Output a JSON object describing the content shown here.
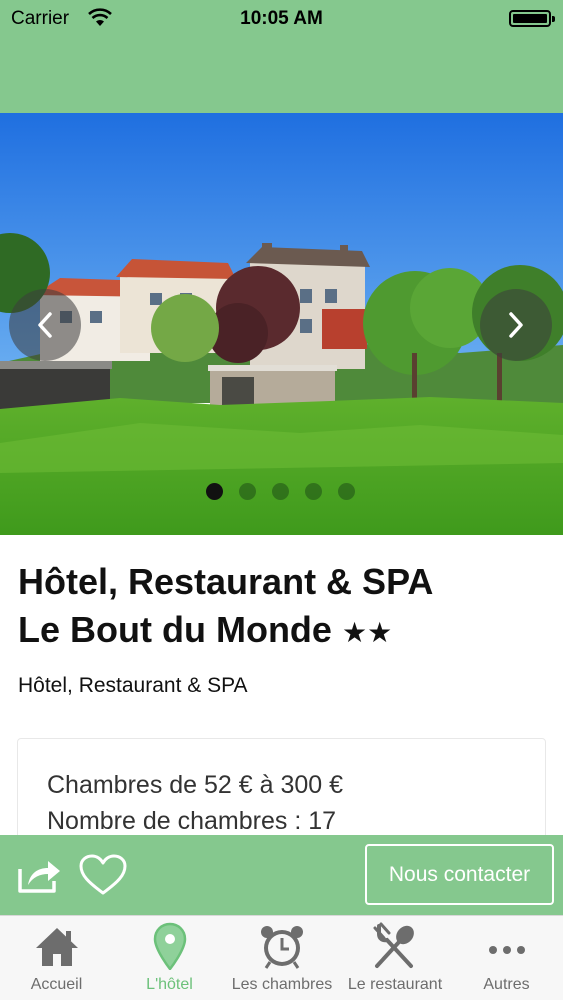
{
  "status_bar": {
    "carrier": "Carrier",
    "time": "10:05 AM"
  },
  "colors": {
    "header_green": "#85c88e",
    "active_tab": "#6cc17a",
    "inactive_tab": "#6d6d6d"
  },
  "carousel": {
    "slide_count": 5,
    "active_index": 0
  },
  "hotel": {
    "title_line1": "Hôtel, Restaurant & SPA",
    "title_line2": "Le Bout du Monde",
    "stars": "★★",
    "subtitle": "Hôtel, Restaurant & SPA"
  },
  "info": {
    "rooms_price": "Chambres de 52 € à 300 €",
    "rooms_count": "Nombre de chambres : 17"
  },
  "actions": {
    "contact_label": "Nous contacter",
    "share_icon": "share-icon",
    "favorite_icon": "heart-icon"
  },
  "tabs": [
    {
      "label": "Accueil",
      "icon": "home-icon"
    },
    {
      "label": "L'hôtel",
      "icon": "map-pin-icon",
      "active": true
    },
    {
      "label": "Les chambres",
      "icon": "alarm-clock-icon"
    },
    {
      "label": "Le restaurant",
      "icon": "fork-spoon-icon"
    },
    {
      "label": "Autres",
      "icon": "more-icon"
    }
  ]
}
